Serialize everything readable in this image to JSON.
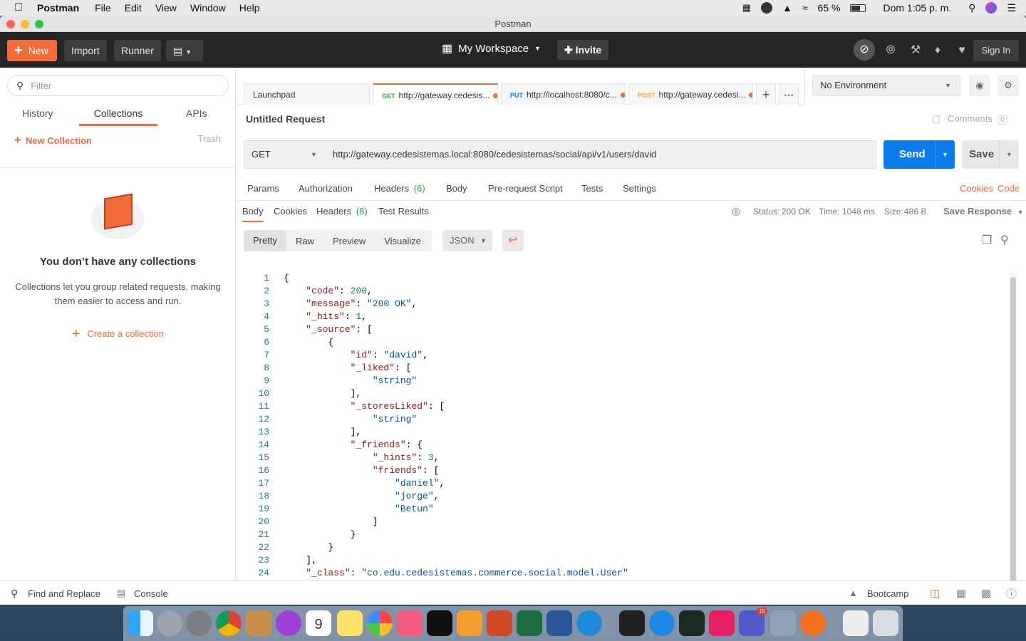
{
  "menubar": {
    "app": "Postman",
    "items": [
      "File",
      "Edit",
      "View",
      "Window",
      "Help"
    ],
    "battery": "65 %",
    "clock": "Dom 1:05 p. m."
  },
  "window": {
    "title": "Postman"
  },
  "toolbar": {
    "new": "New",
    "import": "Import",
    "runner": "Runner",
    "workspace": "My Workspace",
    "invite": "Invite",
    "signin": "Sign In"
  },
  "sidebar": {
    "filter_placeholder": "Filter",
    "tabs": [
      "History",
      "Collections",
      "APIs"
    ],
    "new_collection": "New Collection",
    "trash": "Trash",
    "empty_title": "You don’t have any collections",
    "empty_desc": "Collections let you group related requests, making them easier to access and run.",
    "create": "Create a collection"
  },
  "tabs": [
    {
      "method": "",
      "label": "Launchpad",
      "color": "#333333"
    },
    {
      "method": "GET",
      "label": "http://gateway.cedesis...",
      "color": "#28a745"
    },
    {
      "method": "PUT",
      "label": "http://localhost:8080/c...",
      "color": "#097bed"
    },
    {
      "method": "POST",
      "label": "http://gateway.cedesi...",
      "color": "#f5a623"
    }
  ],
  "environment": "No Environment",
  "request": {
    "title": "Untitled Request",
    "comments": "Comments",
    "comments_count": "0",
    "method": "GET",
    "url": "http://gateway.cedesistemas.local:8080/cedesistemas/social/api/v1/users/david",
    "send": "Send",
    "save": "Save",
    "tabs": {
      "params": "Params",
      "authorization": "Authorization",
      "headers": "Headers",
      "headers_count": "(6)",
      "body": "Body",
      "prerequest": "Pre-request Script",
      "tests": "Tests",
      "settings": "Settings",
      "cookies": "Cookies",
      "code": "Code"
    }
  },
  "response": {
    "tabs": {
      "body": "Body",
      "cookies": "Cookies",
      "headers": "Headers",
      "headers_count": "(8)",
      "test_results": "Test Results"
    },
    "status_label": "Status:",
    "status": "200 OK",
    "time_label": "Time:",
    "time": "1048 ms",
    "size_label": "Size:",
    "size": "486 B",
    "save_response": "Save Response",
    "format_tabs": [
      "Pretty",
      "Raw",
      "Preview",
      "Visualize"
    ],
    "format": "JSON",
    "lines": [
      "{",
      "    \"code\": 200,",
      "    \"message\": \"200 OK\",",
      "    \"_hits\": 1,",
      "    \"_source\": [",
      "        {",
      "            \"id\": \"david\",",
      "            \"_liked\": [",
      "                \"string\"",
      "            ],",
      "            \"_storesLiked\": [",
      "                \"string\"",
      "            ],",
      "            \"_friends\": {",
      "                \"_hints\": 3,",
      "                \"friends\": [",
      "                    \"daniel\",",
      "                    \"jorge\",",
      "                    \"Betun\"",
      "                ]",
      "            }",
      "        }",
      "    ],",
      "    \"_class\": \"co.edu.cedesistemas.commerce.social.model.User\"",
      "}"
    ]
  },
  "statusbar": {
    "find_replace": "Find and Replace",
    "console": "Console",
    "bootcamp": "Bootcamp"
  },
  "dock_badge": "15"
}
